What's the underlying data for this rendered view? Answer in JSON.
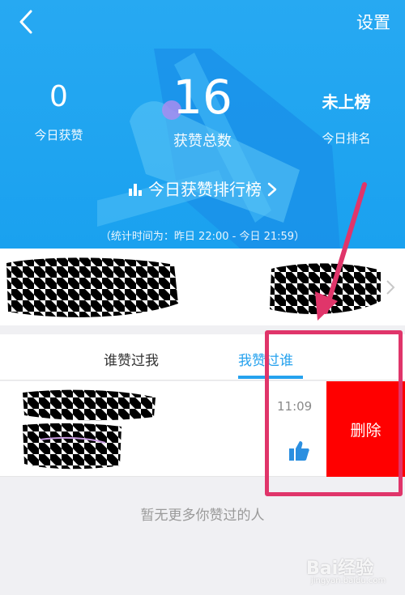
{
  "header": {
    "settings_label": "设置",
    "stats": [
      {
        "value": "0",
        "label": "今日获赞"
      },
      {
        "value": "16",
        "label": "获赞总数"
      },
      {
        "value": "未上榜",
        "label": "今日排名"
      }
    ],
    "rank_link": "今日获赞排行榜",
    "stat_time": "（统计时间为：昨日 22:00 - 今日 21:59）"
  },
  "tabs": [
    {
      "label": "谁赞过我"
    },
    {
      "label": "我赞过谁",
      "active": true
    }
  ],
  "list_item": {
    "time": "11:09",
    "delete_label": "删除"
  },
  "empty_message": "暂无更多你赞过的人",
  "watermark": {
    "text": "Bai经验",
    "sub": "jingyan.baidu.com"
  },
  "colors": {
    "primary": "#26a2ee",
    "delete": "#ff0000",
    "annotation": "#e0356a"
  }
}
